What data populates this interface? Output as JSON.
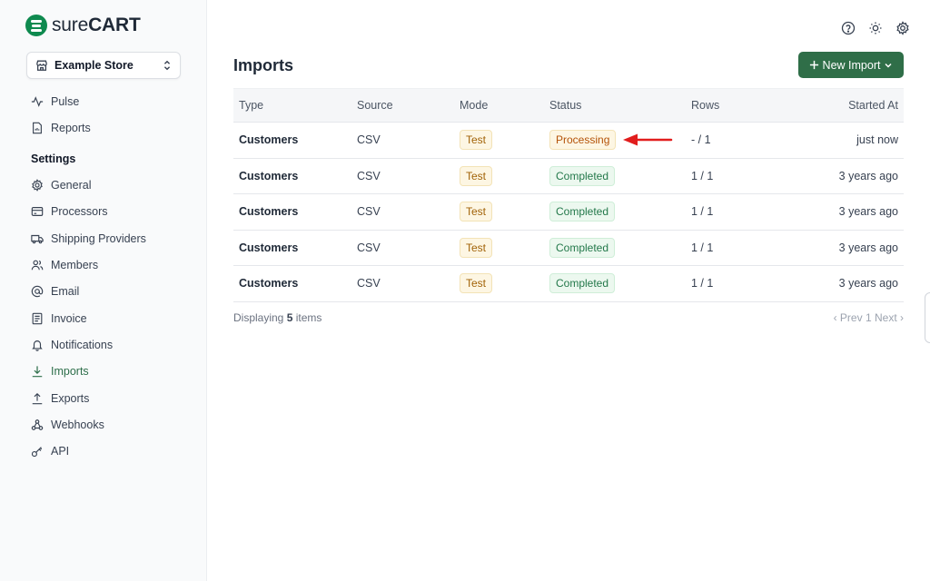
{
  "brand": {
    "name_light": "sure",
    "name_bold": "CART",
    "color": "#0f8a4f"
  },
  "store_selector": {
    "label": "Example Store"
  },
  "sidebar": {
    "items_top": [
      {
        "label": "Pulse",
        "icon": "pulse-icon"
      },
      {
        "label": "Reports",
        "icon": "document-icon"
      }
    ],
    "settings_heading": "Settings",
    "items_settings": [
      {
        "label": "General",
        "icon": "gear-icon"
      },
      {
        "label": "Processors",
        "icon": "credit-card-icon"
      },
      {
        "label": "Shipping Providers",
        "icon": "truck-icon"
      },
      {
        "label": "Members",
        "icon": "users-icon"
      },
      {
        "label": "Email",
        "icon": "at-sign-icon"
      },
      {
        "label": "Invoice",
        "icon": "invoice-icon"
      },
      {
        "label": "Notifications",
        "icon": "bell-icon"
      },
      {
        "label": "Imports",
        "icon": "download-icon",
        "active": true
      },
      {
        "label": "Exports",
        "icon": "upload-icon"
      },
      {
        "label": "Webhooks",
        "icon": "webhook-icon"
      },
      {
        "label": "API",
        "icon": "key-icon"
      }
    ],
    "active_color": "#2d6e4a"
  },
  "header": {
    "icons": [
      "help-icon",
      "sun-icon",
      "gear-icon"
    ]
  },
  "page": {
    "title": "Imports",
    "new_button": "New Import",
    "button_color": "#2f6e48"
  },
  "table": {
    "columns": [
      "Type",
      "Source",
      "Mode",
      "Status",
      "Rows",
      "Started At"
    ],
    "rows": [
      {
        "type": "Customers",
        "source": "CSV",
        "mode": "Test",
        "status": "Processing",
        "rows": "- / 1",
        "started": "just now"
      },
      {
        "type": "Customers",
        "source": "CSV",
        "mode": "Test",
        "status": "Completed",
        "rows": "1 / 1",
        "started": "3 years ago"
      },
      {
        "type": "Customers",
        "source": "CSV",
        "mode": "Test",
        "status": "Completed",
        "rows": "1 / 1",
        "started": "3 years ago"
      },
      {
        "type": "Customers",
        "source": "CSV",
        "mode": "Test",
        "status": "Completed",
        "rows": "1 / 1",
        "started": "3 years ago"
      },
      {
        "type": "Customers",
        "source": "CSV",
        "mode": "Test",
        "status": "Completed",
        "rows": "1 / 1",
        "started": "3 years ago"
      }
    ]
  },
  "footer": {
    "displaying_prefix": "Displaying",
    "count": "5",
    "displaying_suffix": "items",
    "prev": "‹ Prev",
    "page": "1",
    "next": "Next ›"
  }
}
